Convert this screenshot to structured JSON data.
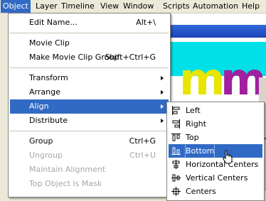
{
  "menubar": {
    "items": [
      {
        "label": "Object",
        "active": true
      },
      {
        "label": "Layer"
      },
      {
        "label": "Timeline"
      },
      {
        "label": "View"
      },
      {
        "label": "Window"
      },
      {
        "label": "Scripts"
      },
      {
        "label": "Automation"
      },
      {
        "label": "Help"
      }
    ]
  },
  "object_menu": {
    "items": [
      {
        "label": "Edit Name...",
        "shortcut": "Alt+\\"
      },
      {
        "label": "Movie Clip",
        "shortcut": ""
      },
      {
        "label": "Make Movie Clip Group",
        "shortcut": "Shift+Ctrl+G"
      },
      {
        "label": "Transform",
        "shortcut": ""
      },
      {
        "label": "Arrange",
        "shortcut": ""
      },
      {
        "label": "Align",
        "shortcut": ""
      },
      {
        "label": "Distribute",
        "shortcut": ""
      },
      {
        "label": "Group",
        "shortcut": "Ctrl+G"
      },
      {
        "label": "Ungroup",
        "shortcut": "Ctrl+U"
      },
      {
        "label": "Maintain Alignment",
        "shortcut": ""
      },
      {
        "label": "Top Object Is Mask",
        "shortcut": ""
      }
    ]
  },
  "align_submenu": {
    "items": [
      {
        "label": "Left",
        "icon": "align-left-icon"
      },
      {
        "label": "Right",
        "icon": "align-right-icon"
      },
      {
        "label": "Top",
        "icon": "align-top-icon"
      },
      {
        "label": "Bottom",
        "icon": "align-bottom-icon"
      },
      {
        "label": "Horizontal Centers",
        "icon": "align-horizontal-centers-icon"
      },
      {
        "label": "Vertical Centers",
        "icon": "align-vertical-centers-icon"
      },
      {
        "label": "Centers",
        "icon": "align-centers-icon"
      }
    ]
  },
  "stage": {
    "glyphs": "mm"
  },
  "colors": {
    "highlight": "#316ac5",
    "menu_bg": "#ffffff",
    "disabled_text": "#a7a6aa",
    "stage_cyan": "#00e0e8",
    "glyph_yellow": "#e6e600",
    "glyph_purple": "#a020a0"
  }
}
